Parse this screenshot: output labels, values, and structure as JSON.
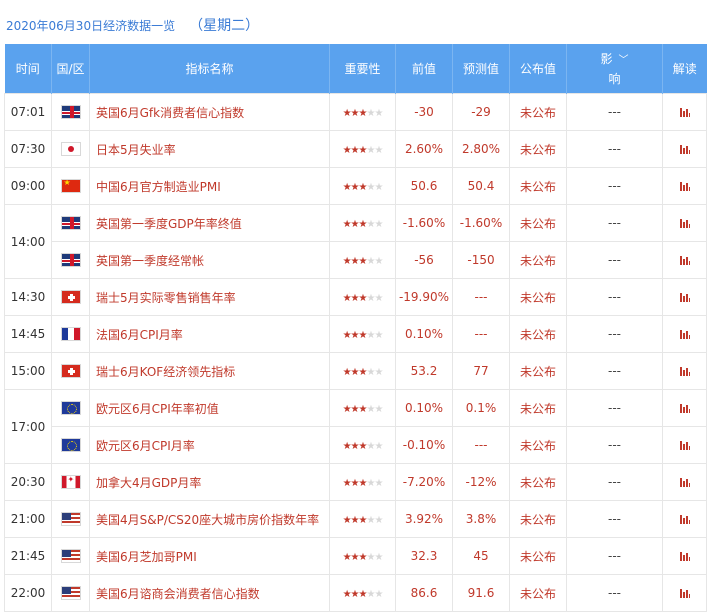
{
  "header": {
    "date_title": "2020年06月30日经济数据一览",
    "weekday": "（星期二）"
  },
  "columns": {
    "time": "时间",
    "region": "国/区",
    "indicator": "指标名称",
    "importance": "重要性",
    "previous": "前值",
    "forecast": "预测值",
    "actual": "公布值",
    "impact_line1": "影",
    "impact_line2": "响",
    "interpret": "解读"
  },
  "icons": {
    "impact_dropdown": "chevron-down-icon",
    "interpret": "bar-chart-icon"
  },
  "colors": {
    "header_bg": "#5aa2ee",
    "value_red": "#c0392b",
    "title_blue": "#3a7bd5"
  },
  "groups": [
    {
      "time": "07:01",
      "rows": [
        {
          "flag": "gb",
          "name": "英国6月Gfk消费者信心指数",
          "stars": 3,
          "previous": "-30",
          "forecast": "-29",
          "actual": "未公布",
          "impact": "---"
        }
      ]
    },
    {
      "time": "07:30",
      "rows": [
        {
          "flag": "jp",
          "name": "日本5月失业率",
          "stars": 3,
          "previous": "2.60%",
          "forecast": "2.80%",
          "actual": "未公布",
          "impact": "---"
        }
      ]
    },
    {
      "time": "09:00",
      "rows": [
        {
          "flag": "cn",
          "name": "中国6月官方制造业PMI",
          "stars": 3,
          "previous": "50.6",
          "forecast": "50.4",
          "actual": "未公布",
          "impact": "---"
        }
      ]
    },
    {
      "time": "14:00",
      "rows": [
        {
          "flag": "gb",
          "name": "英国第一季度GDP年率终值",
          "stars": 3,
          "previous": "-1.60%",
          "forecast": "-1.60%",
          "actual": "未公布",
          "impact": "---"
        },
        {
          "flag": "gb",
          "name": "英国第一季度经常帐",
          "stars": 3,
          "previous": "-56",
          "forecast": "-150",
          "actual": "未公布",
          "impact": "---"
        }
      ]
    },
    {
      "time": "14:30",
      "rows": [
        {
          "flag": "ch",
          "name": "瑞士5月实际零售销售年率",
          "stars": 3,
          "previous": "-19.90%",
          "forecast": "---",
          "actual": "未公布",
          "impact": "---"
        }
      ]
    },
    {
      "time": "14:45",
      "rows": [
        {
          "flag": "fr",
          "name": "法国6月CPI月率",
          "stars": 3,
          "previous": "0.10%",
          "forecast": "---",
          "actual": "未公布",
          "impact": "---"
        }
      ]
    },
    {
      "time": "15:00",
      "rows": [
        {
          "flag": "ch",
          "name": "瑞士6月KOF经济领先指标",
          "stars": 3,
          "previous": "53.2",
          "forecast": "77",
          "actual": "未公布",
          "impact": "---"
        }
      ]
    },
    {
      "time": "17:00",
      "rows": [
        {
          "flag": "eu",
          "name": "欧元区6月CPI年率初值",
          "stars": 3,
          "previous": "0.10%",
          "forecast": "0.1%",
          "actual": "未公布",
          "impact": "---"
        },
        {
          "flag": "eu",
          "name": "欧元区6月CPI月率",
          "stars": 3,
          "previous": "-0.10%",
          "forecast": "---",
          "actual": "未公布",
          "impact": "---"
        }
      ]
    },
    {
      "time": "20:30",
      "rows": [
        {
          "flag": "ca",
          "name": "加拿大4月GDP月率",
          "stars": 3,
          "previous": "-7.20%",
          "forecast": "-12%",
          "actual": "未公布",
          "impact": "---"
        }
      ]
    },
    {
      "time": "21:00",
      "rows": [
        {
          "flag": "us",
          "name": "美国4月S&P/CS20座大城市房价指数年率",
          "stars": 3,
          "previous": "3.92%",
          "forecast": "3.8%",
          "actual": "未公布",
          "impact": "---"
        }
      ]
    },
    {
      "time": "21:45",
      "rows": [
        {
          "flag": "us",
          "name": "美国6月芝加哥PMI",
          "stars": 3,
          "previous": "32.3",
          "forecast": "45",
          "actual": "未公布",
          "impact": "---"
        }
      ]
    },
    {
      "time": "22:00",
      "rows": [
        {
          "flag": "us",
          "name": "美国6月谘商会消费者信心指数",
          "stars": 3,
          "previous": "86.6",
          "forecast": "91.6",
          "actual": "未公布",
          "impact": "---"
        }
      ]
    }
  ]
}
